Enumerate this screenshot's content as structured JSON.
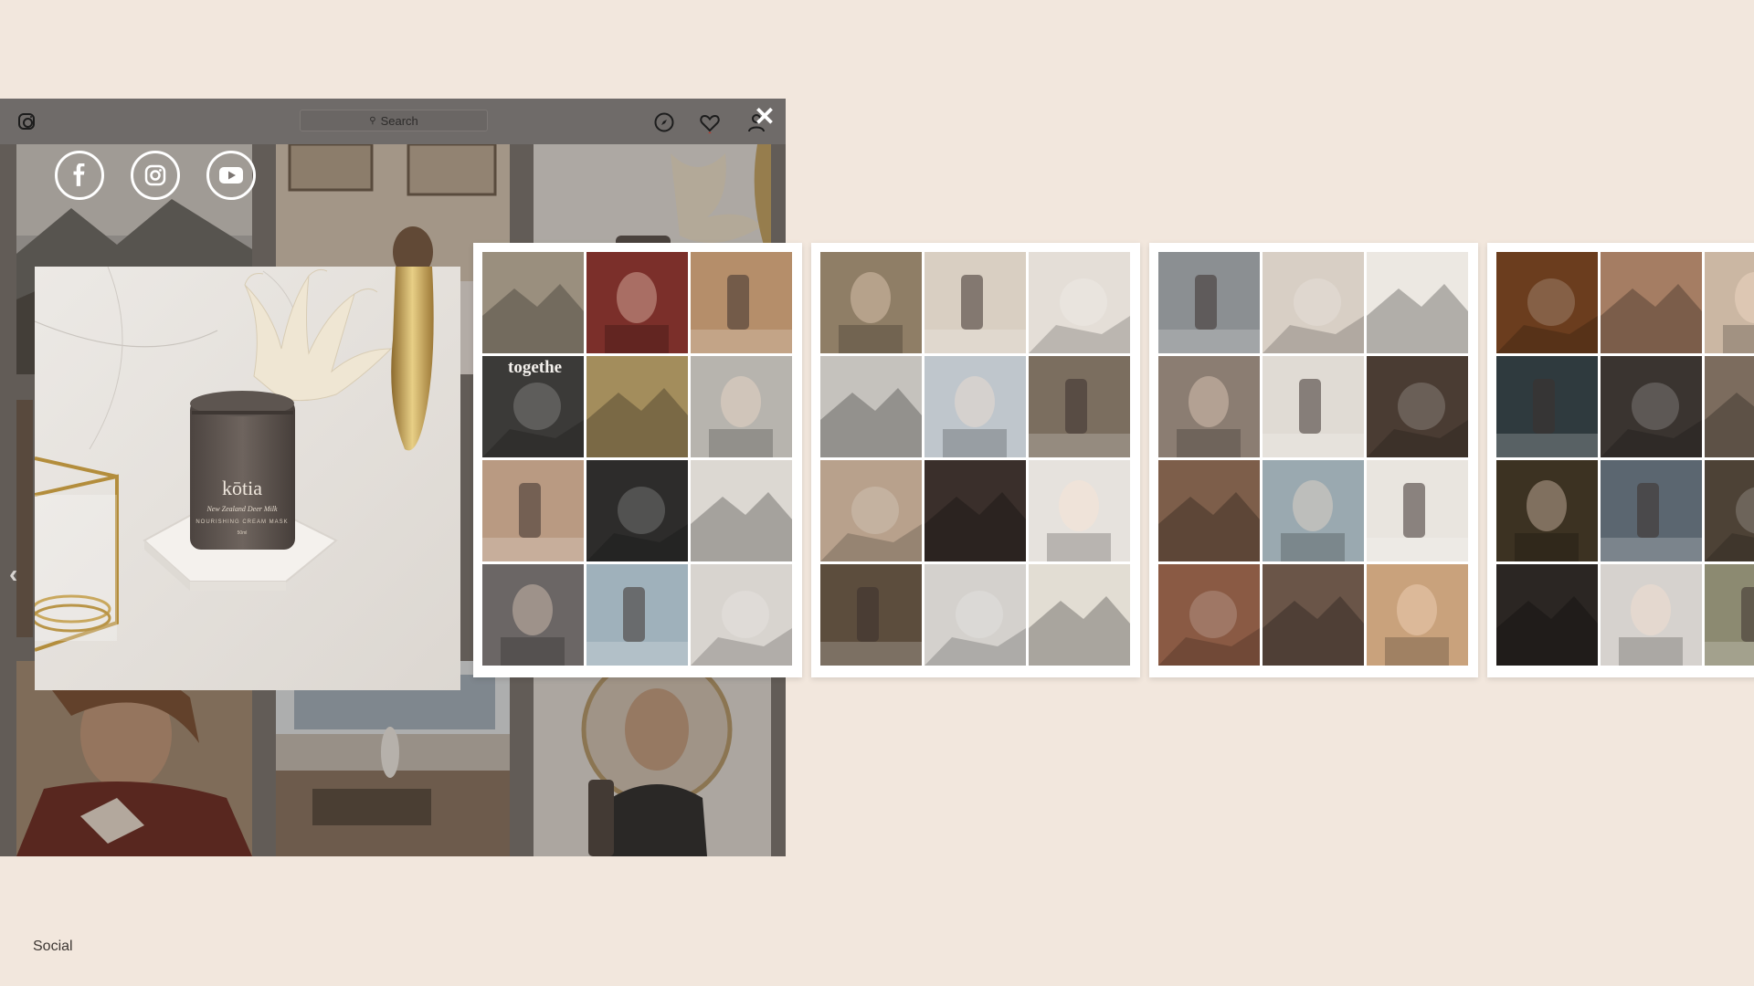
{
  "search": {
    "placeholder": "Search",
    "glyph": "⚲"
  },
  "close_label": "✕",
  "prev_label": "‹",
  "caption": "Social",
  "brand": {
    "name": "kōtia",
    "product": "New Zealand Deer Milk",
    "subline": "NOURISHING CREAM MASK",
    "size": "50ml"
  },
  "overlay_text": "togethe",
  "colors": {
    "page_bg": "#f2e7dd",
    "ig_frame": "#7c7672",
    "card_bg": "#ffffff",
    "jar": "#5f5651"
  },
  "social_icons": [
    "facebook-icon",
    "instagram-icon",
    "youtube-icon"
  ],
  "cards": [
    {
      "tiles": [
        "#9a8f7e",
        "#7b2f2a",
        "#b58e6a",
        "#3b3a38",
        "#a38d5c",
        "#b7b4ae",
        "#b99a82",
        "#2d2c2b",
        "#dcd8d2",
        "#6b6665",
        "#9fb1bb",
        "#d8d4cf"
      ]
    },
    {
      "tiles": [
        "#8f7e66",
        "#d9cfc2",
        "#e4ded7",
        "#c5c2bd",
        "#bfc6cc",
        "#7b6e5f",
        "#b8a18c",
        "#3a2f2b",
        "#e6e2dd",
        "#5c4d3d",
        "#d4d1cd",
        "#e2ddd3"
      ]
    },
    {
      "tiles": [
        "#8b8f92",
        "#d8cfc5",
        "#ece8e2",
        "#8b7d72",
        "#e0dbd4",
        "#4a3c33",
        "#7d5e4a",
        "#9aa9b0",
        "#e9e5df",
        "#8a5a44",
        "#6a5548",
        "#c9a27c"
      ]
    },
    {
      "tiles": [
        "#6b3d1e",
        "#a57d63",
        "#cbb7a3",
        "#2f3a3e",
        "#3a3430",
        "#7c6c5e",
        "#3c3222",
        "#5b6670",
        "#4d4236",
        "#2b2623",
        "#d6d2ce",
        "#8c8a71"
      ]
    }
  ]
}
